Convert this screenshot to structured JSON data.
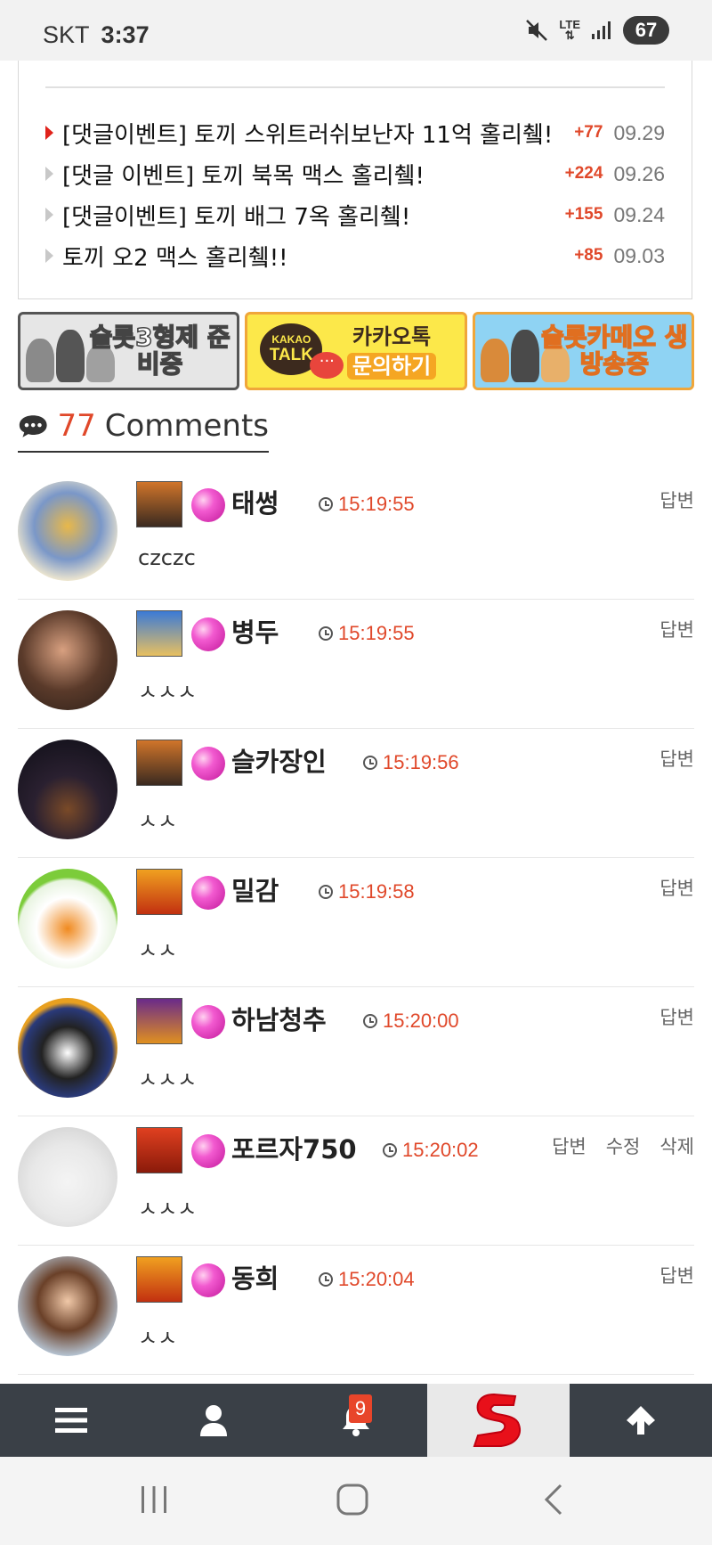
{
  "status_bar": {
    "carrier": "SKT",
    "time": "3:37",
    "network": "LTE",
    "battery": "67"
  },
  "notices": [
    {
      "title": "[댓글이벤트] 토끼 스위트러쉬보난자 11억 홀리췤!",
      "count": "+77",
      "date": "09.29",
      "active": true
    },
    {
      "title": "[댓글 이벤트] 토끼 북목 맥스 홀리췤!",
      "count": "+224",
      "date": "09.26",
      "active": false
    },
    {
      "title": "[댓글이벤트] 토끼 배그 7옥 홀리췤!",
      "count": "+155",
      "date": "09.24",
      "active": false
    },
    {
      "title": "토끼 오2 맥스 홀리췤!!",
      "count": "+85",
      "date": "09.03",
      "active": false
    }
  ],
  "banners": {
    "slot_brothers": "슬롯3형제 준비중",
    "kakao_small": "KAKAO",
    "kakao_talk": "TALK",
    "kakao_title": "카카오톡",
    "kakao_sub": "문의하기",
    "slot_cameo": "슬롯카메오 생방송중"
  },
  "comments_header": {
    "count": "77",
    "label": "Comments"
  },
  "comments": [
    {
      "nick": "태썽",
      "time": "15:19:55",
      "text": "czczc",
      "actions": [
        "답변"
      ]
    },
    {
      "nick": "병두",
      "time": "15:19:55",
      "text": "ㅅㅅㅅ",
      "actions": [
        "답변"
      ]
    },
    {
      "nick": "슬카장인",
      "time": "15:19:56",
      "text": "ㅅㅅ",
      "actions": [
        "답변"
      ]
    },
    {
      "nick": "밀감",
      "time": "15:19:58",
      "text": "ㅅㅅ",
      "actions": [
        "답변"
      ]
    },
    {
      "nick": "하남청추",
      "time": "15:20:00",
      "text": "ㅅㅅㅅ",
      "actions": [
        "답변"
      ]
    },
    {
      "nick": "포르자750",
      "time": "15:20:02",
      "text": "ㅅㅅㅅ",
      "actions": [
        "답변",
        "수정",
        "삭제"
      ]
    },
    {
      "nick": "동희",
      "time": "15:20:04",
      "text": "ㅅㅅ",
      "actions": [
        "답변"
      ]
    }
  ],
  "bottom_nav": {
    "notification_count": "9"
  },
  "colors": {
    "accent": "#e0482a",
    "nav_bg": "#3a4047",
    "gem": "#f25ad0"
  }
}
